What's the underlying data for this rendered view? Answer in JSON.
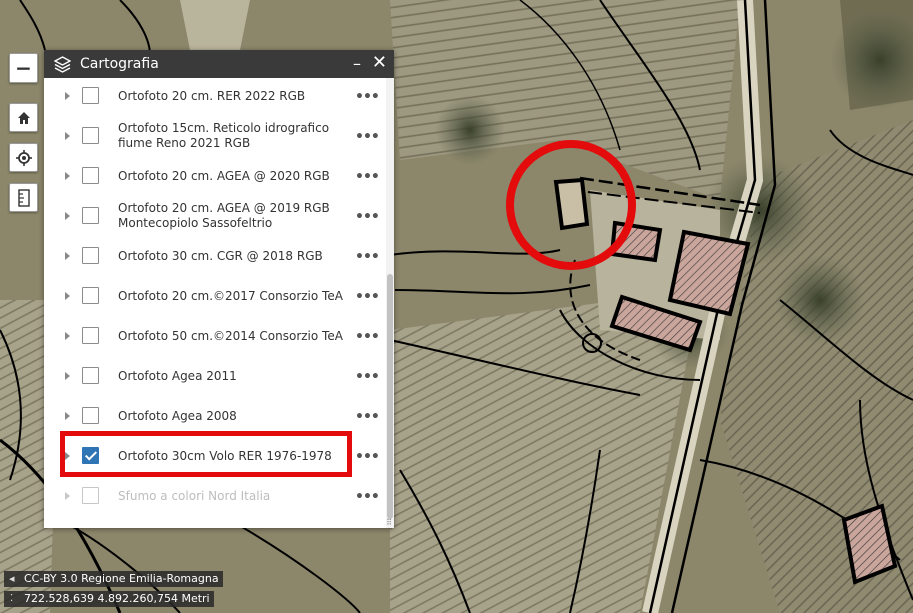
{
  "panel": {
    "title": "Cartografia",
    "minimize_icon": "minimize-icon",
    "close_icon": "close-icon",
    "layers": [
      {
        "label": "Ortofoto 20 cm. RER 2022 RGB",
        "checked": false,
        "enabled": true
      },
      {
        "label": "Ortofoto 15cm. Reticolo idrografico fiume Reno 2021 RGB",
        "checked": false,
        "enabled": true
      },
      {
        "label": "Ortofoto 20 cm. AGEA @ 2020 RGB",
        "checked": false,
        "enabled": true
      },
      {
        "label": "Ortofoto 20 cm. AGEA @ 2019 RGB Montecopiolo Sassofeltrio",
        "checked": false,
        "enabled": true
      },
      {
        "label": "Ortofoto 30 cm. CGR @ 2018 RGB",
        "checked": false,
        "enabled": true
      },
      {
        "label": "Ortofoto 20 cm.©2017 Consorzio TeA",
        "checked": false,
        "enabled": true
      },
      {
        "label": "Ortofoto 50 cm.©2014 Consorzio TeA",
        "checked": false,
        "enabled": true
      },
      {
        "label": "Ortofoto Agea 2011",
        "checked": false,
        "enabled": true
      },
      {
        "label": "Ortofoto Agea 2008",
        "checked": false,
        "enabled": true
      },
      {
        "label": "Ortofoto 30cm Volo RER 1976-1978",
        "checked": true,
        "enabled": true
      },
      {
        "label": "Sfumo a colori Nord Italia",
        "checked": false,
        "enabled": false
      }
    ]
  },
  "map_controls": {
    "zoom_out": "−",
    "icons": [
      "home-icon",
      "locate-icon",
      "measure-icon"
    ]
  },
  "attribution": {
    "text": "CC-BY 3.0 Regione Emilia-Romagna",
    "toggle": "◂"
  },
  "coordinates": {
    "text": "722.528,639 4.892.260,754 Metri",
    "icon": "⁚"
  },
  "colors": {
    "highlight": "#e30b0b",
    "panel_header": "#3a3a3a",
    "checkbox_checked": "#2f74b5"
  }
}
